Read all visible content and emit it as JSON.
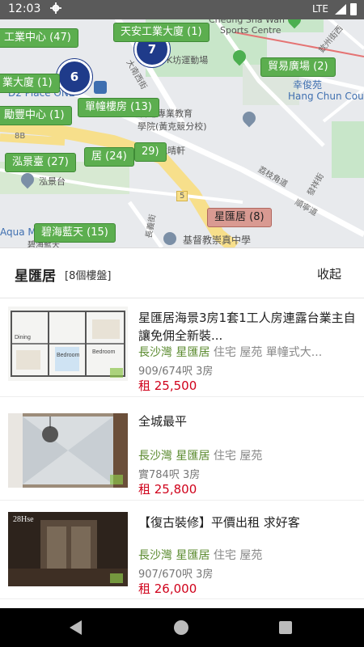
{
  "status": {
    "time": "12:03",
    "network": "LTE"
  },
  "map": {
    "pins": [
      {
        "label": "工業中心 (47)",
        "style": "green"
      },
      {
        "label": "天安工業大廈 (1)",
        "style": "green"
      },
      {
        "label": "貿易廣場 (2)",
        "style": "green"
      },
      {
        "label": "業大廈 (1)",
        "style": "green"
      },
      {
        "label": "單幢樓房 (13)",
        "style": "green"
      },
      {
        "label": "勵豐中心 (1)",
        "style": "green"
      },
      {
        "label": "居 (24)",
        "style": "green"
      },
      {
        "label": "29)",
        "style": "green"
      },
      {
        "label": "泓景臺 (27)",
        "style": "green"
      },
      {
        "label": "星匯居 (8)",
        "style": "selected"
      },
      {
        "label": "碧海藍天 (15)",
        "style": "green"
      }
    ],
    "clusters": [
      "7",
      "6"
    ],
    "labels": [
      "Cheung Sha Wan",
      "Sports Centre",
      "K坊運動場",
      "幸俊苑",
      "Hang Chun Court",
      "D2 Place ONE",
      "大南西街",
      "香港專業教育",
      "學院(黃克競分校)",
      "悅晴軒",
      "8B",
      "泓景台",
      "荔枝角道",
      "發祥街",
      "5",
      "Aqua M",
      "碧海藍天",
      "基督教崇真中學",
      "順寧道",
      "長義街",
      "欽州街西"
    ]
  },
  "sheet": {
    "title": "星匯居",
    "count": "[8個樓盤]",
    "collapse": "收起"
  },
  "listings": [
    {
      "title": "星匯居海景3房1套1工人房連露台業主自讓免佣全新裝...",
      "district": "長沙灣",
      "estate": "星匯居",
      "type": "住宅 屋苑 單幢式大...",
      "size": "909/674呎 3房",
      "price": "租 25,500",
      "thumb": "floorplan"
    },
    {
      "title": "全城最平",
      "district": "長沙灣",
      "estate": "星匯居",
      "type": "住宅 屋苑",
      "size": "實784呎 3房",
      "price": "租 25,800",
      "thumb": "mirror"
    },
    {
      "title": "【復古裝修】平價出租 求好客",
      "district": "長沙灣",
      "estate": "星匯居",
      "type": "住宅 屋苑",
      "size": "907/670呎 3房",
      "price": "租 26,000",
      "thumb": "room",
      "thumb_caption": "28Hse"
    }
  ]
}
